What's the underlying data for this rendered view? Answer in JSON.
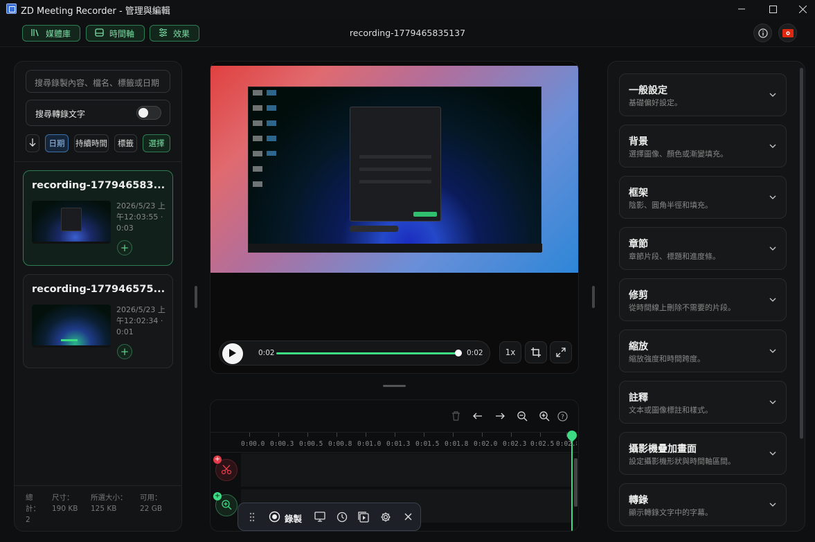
{
  "window": {
    "title": "ZD Meeting Recorder - 管理與編輯",
    "minimize_icon": "minimize-icon",
    "maximize_icon": "maximize-icon",
    "close_icon": "close-icon"
  },
  "toolbar": {
    "tabs": [
      {
        "label": "媒體庫",
        "icon": "library-icon"
      },
      {
        "label": "時間軸",
        "icon": "timeline-icon"
      },
      {
        "label": "效果",
        "icon": "effects-icon"
      }
    ],
    "recording_title": "recording-1779465835137",
    "info_icon": "info-icon",
    "flag_icon": "hong-kong-flag-icon"
  },
  "library": {
    "search_placeholder": "搜尋錄製內容、檔名、標籤或日期",
    "transcript_search_label": "搜尋轉錄文字",
    "transcript_search_on": false,
    "sort_buttons": [
      "日期",
      "持續時間",
      "標籤"
    ],
    "select_label": "選擇",
    "recordings": [
      {
        "title": "recording-177946583...",
        "date_line1": "2026/5/23 上",
        "date_line2": "午12:03:55 ·",
        "duration": "0:03"
      },
      {
        "title": "recording-177946575...",
        "date_line1": "2026/5/23 上",
        "date_line2": "午12:02:34 ·",
        "duration": "0:01"
      }
    ],
    "stats": {
      "total_label": "總",
      "total_label2": "計：",
      "total_value": "2",
      "size_label": "尺寸：",
      "size_value": "190 KB",
      "selected_label": "所選大小：",
      "selected_value": "125 KB",
      "available_label": "可用：",
      "available_value": "22 GB"
    }
  },
  "player": {
    "current_time": "0:02",
    "total_time": "0:02",
    "progress": 1.0,
    "speed": "1x"
  },
  "timeline": {
    "ticks": [
      "0:00.0",
      "0:00.3",
      "0:00.5",
      "0:00.8",
      "0:01.0",
      "0:01.3",
      "0:01.5",
      "0:01.8",
      "0:02.0",
      "0:02.3",
      "0:02.5",
      "0:02.8"
    ]
  },
  "floatbar": {
    "record_label": "錄製"
  },
  "settings": {
    "sections": [
      {
        "title": "一般設定",
        "subtitle": "基礎偏好設定。"
      },
      {
        "title": "背景",
        "subtitle": "選擇圖像、顏色或漸變填充。"
      },
      {
        "title": "框架",
        "subtitle": "陰影、圓角半徑和填充。"
      },
      {
        "title": "章節",
        "subtitle": "章節片段、標題和進度條。"
      },
      {
        "title": "修剪",
        "subtitle": "從時間線上刪除不需要的片段。"
      },
      {
        "title": "縮放",
        "subtitle": "縮放強度和時間跨度。"
      },
      {
        "title": "註釋",
        "subtitle": "文本或圖像標註和樣式。"
      },
      {
        "title": "攝影機疊加畫面",
        "subtitle": "設定攝影機形狀與時間軸區間。"
      },
      {
        "title": "轉錄",
        "subtitle": "顯示轉錄文字中的字幕。"
      }
    ]
  },
  "colors": {
    "accent": "#3ddc84",
    "accent_dark": "#2f7d55",
    "danger": "#e23b4a",
    "background": "#0e0f10"
  }
}
